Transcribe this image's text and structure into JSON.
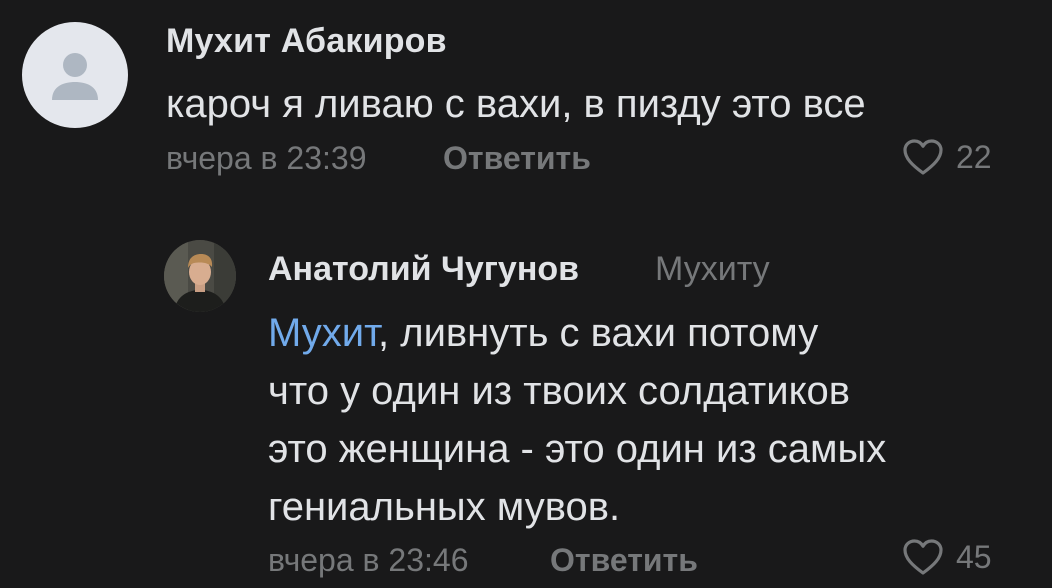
{
  "comments": [
    {
      "author": "Мухит Абакиров",
      "text": "кароч я ливаю с вахи, в пизду это все",
      "time": "вчера в 23:39",
      "reply_label": "Ответить",
      "likes": "22",
      "avatar": "user-placeholder-icon"
    },
    {
      "author": "Анатолий Чугунов",
      "reply_to": "Мухиту",
      "mention": "Мухит",
      "text_lines": [
        ", ливнуть с вахи потому",
        "что у один из твоих солдатиков",
        "это женщина - это один из самых",
        "гениальных мувов."
      ],
      "time": "вчера в 23:46",
      "reply_label": "Ответить",
      "likes": "45",
      "avatar": "user-photo"
    }
  ],
  "colors": {
    "background": "#19191a",
    "text": "#e1e3e6",
    "secondary": "#76787a",
    "link": "#71aaeb",
    "avatar_placeholder": "#e4e7ed"
  }
}
